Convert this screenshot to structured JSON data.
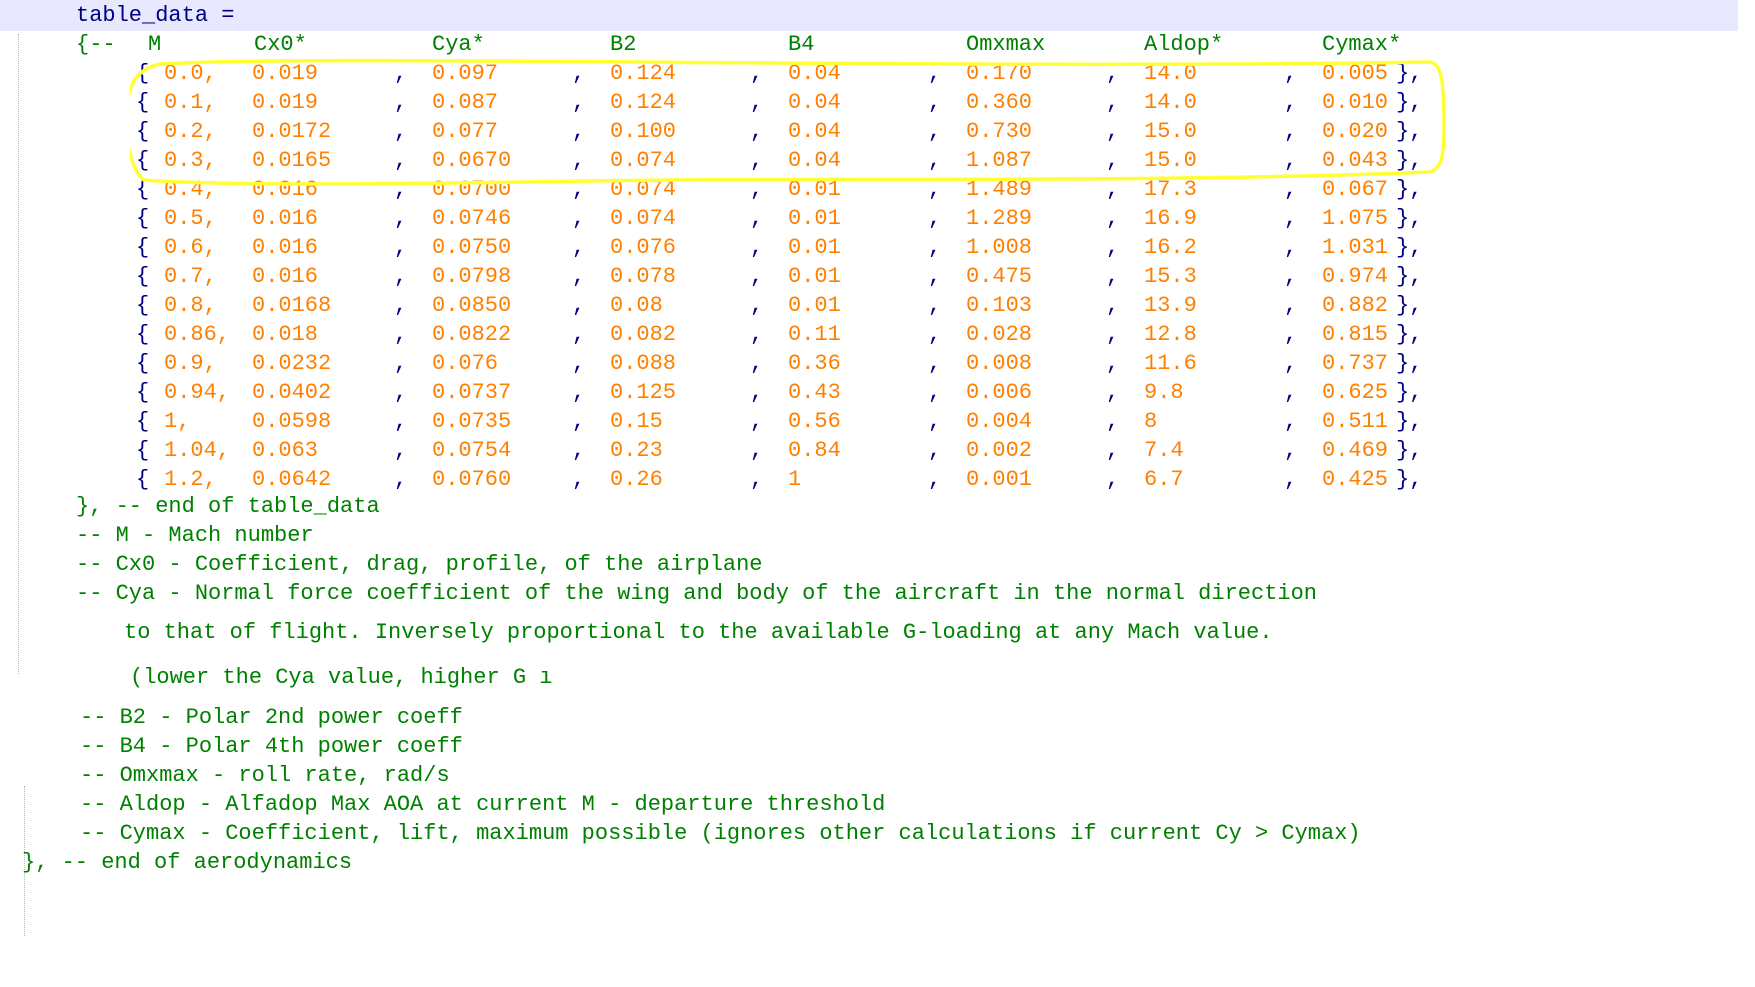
{
  "assign_line": "table_data =",
  "header": {
    "open": "{--",
    "cols": [
      "M",
      "Cx0*",
      "Cya*",
      "B2",
      "B4",
      "Omxmax",
      "Aldop*",
      "Cymax*"
    ]
  },
  "rows": [
    [
      "0.0,",
      "0.019",
      "0.097",
      "0.124",
      "0.04",
      "0.170",
      "14.0",
      "0.005"
    ],
    [
      "0.1,",
      "0.019",
      "0.087",
      "0.124",
      "0.04",
      "0.360",
      "14.0",
      "0.010"
    ],
    [
      "0.2,",
      "0.0172",
      "0.077",
      "0.100",
      "0.04",
      "0.730",
      "15.0",
      "0.020"
    ],
    [
      "0.3,",
      "0.0165",
      "0.0670",
      "0.074",
      "0.04",
      "1.087",
      "15.0",
      "0.043"
    ],
    [
      "0.4,",
      "0.016",
      "0.0700",
      "0.074",
      "0.01",
      "1.489",
      "17.3",
      "0.067"
    ],
    [
      "0.5,",
      "0.016",
      "0.0746",
      "0.074",
      "0.01",
      "1.289",
      "16.9",
      "1.075"
    ],
    [
      "0.6,",
      "0.016",
      "0.0750",
      "0.076",
      "0.01",
      "1.008",
      "16.2",
      "1.031"
    ],
    [
      "0.7,",
      "0.016",
      "0.0798",
      "0.078",
      "0.01",
      "0.475",
      "15.3",
      "0.974"
    ],
    [
      "0.8,",
      "0.0168",
      "0.0850",
      "0.08",
      "0.01",
      "0.103",
      "13.9",
      "0.882"
    ],
    [
      "0.86,",
      "0.018",
      "0.0822",
      "0.082",
      "0.11",
      "0.028",
      "12.8",
      "0.815"
    ],
    [
      "0.9,",
      "0.0232",
      "0.076",
      "0.088",
      "0.36",
      "0.008",
      "11.6",
      "0.737"
    ],
    [
      "0.94,",
      "0.0402",
      "0.0737",
      "0.125",
      "0.43",
      "0.006",
      "9.8",
      "0.625"
    ],
    [
      "1,",
      "0.0598",
      "0.0735",
      "0.15",
      "0.56",
      "0.004",
      "8",
      "0.511"
    ],
    [
      "1.04,",
      "0.063",
      "0.0754",
      "0.23",
      "0.84",
      "0.002",
      "7.4",
      "0.469"
    ],
    [
      "1.2,",
      "0.0642",
      "0.0760",
      "0.26",
      "1",
      "0.001",
      "6.7",
      "0.425"
    ]
  ],
  "end_table_comment": "}, -- end of table_data",
  "comments": [
    "-- M - Mach number",
    "-- Cx0 - Coefficient, drag, profile, of the airplane",
    "-- Cya - Normal force coefficient of the wing and body of the aircraft in the normal direction",
    "to that of flight. Inversely proportional to the available G-loading at any Mach value.",
    "(lower the Cya value, higher G ı",
    "-- B2 - Polar 2nd power coeff",
    "-- B4 - Polar 4th power coeff",
    "-- Omxmax - roll rate, rad/s",
    "-- Aldop - Alfadop Max AOA at current M - departure threshold",
    "-- Cymax - Coefficient, lift, maximum possible (ignores other calculations if current Cy > Cymax)"
  ],
  "end_aero_comment": "}, -- end of aerodynamics",
  "colors": {
    "keyword": "#000080",
    "number": "#ff8000",
    "comment": "#008000",
    "current_line": "#e8e8ff",
    "annotation": "#ffff33"
  }
}
